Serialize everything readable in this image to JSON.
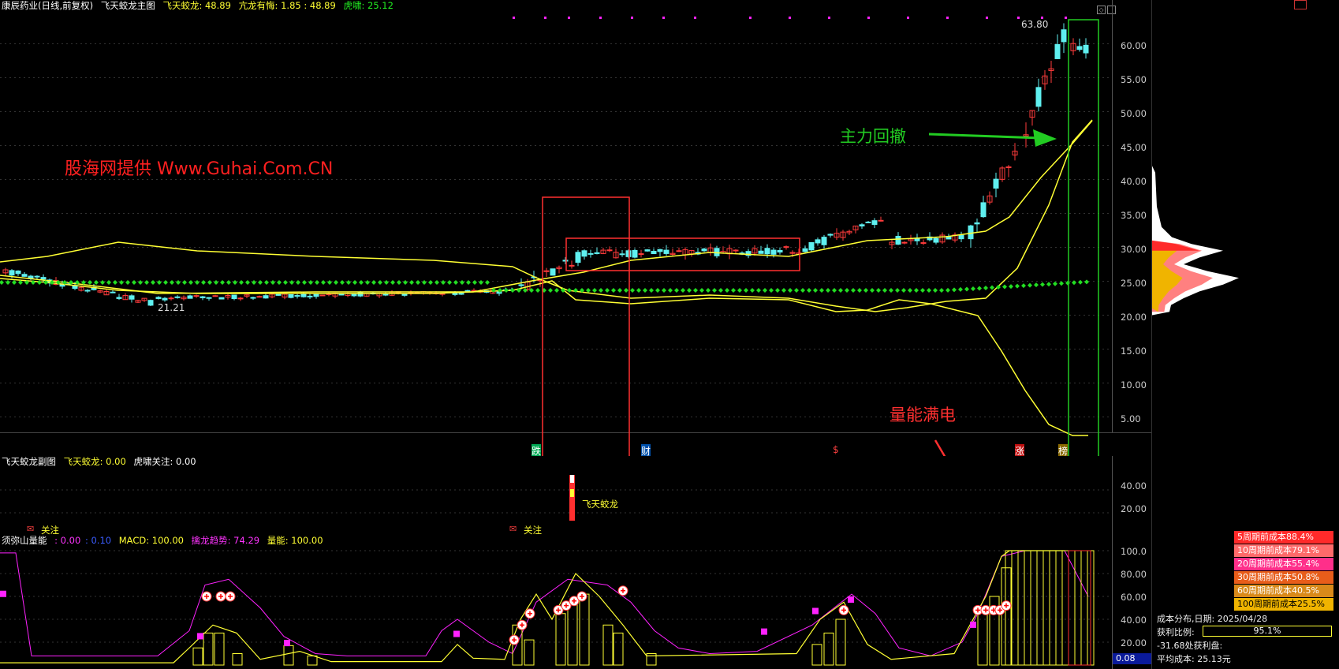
{
  "main_header": {
    "stock": "康辰药业(日线,前复权)",
    "indicator": "飞天蛟龙主图",
    "v1_label": "飞天蛟龙: 48.89",
    "v2_label": "亢龙有悔: 1.85 : 48.89",
    "v3_label": "虎啸: 25.12"
  },
  "main_annotations": {
    "watermark": "股海网提供 Www.Guhai.Com.CN",
    "pullback": "主力回撤",
    "energy": "量能满电",
    "high_price": "63.80",
    "low_price": "21.21"
  },
  "signal_marks": [
    "跌",
    "财",
    "$",
    "涨",
    "榜"
  ],
  "main_axis": [
    "60.00",
    "55.00",
    "50.00",
    "45.00",
    "40.00",
    "35.00",
    "30.00",
    "25.00",
    "20.00",
    "15.00",
    "10.00",
    "5.00"
  ],
  "sub_header": {
    "name": "飞天蛟龙副图",
    "v1": "飞天蛟龙: 0.00",
    "v2": "虎啸关注: 0.00"
  },
  "sub_annotations": {
    "dragon": "飞天蛟龙",
    "focus1": "关注",
    "focus2": "关注"
  },
  "sub_axis": [
    "40.00",
    "20.00"
  ],
  "vol_header": {
    "name": "须弥山量能",
    "v1": ": 0.00",
    "v2": ": 0.10",
    "v3": "MACD: 100.00",
    "v4": "擒龙趋势: 74.29",
    "v5": "量能: 100.00"
  },
  "vol_axis": [
    "100.0",
    "80.00",
    "60.00",
    "40.00",
    "20.00"
  ],
  "vol_axis_badge": "0.08",
  "cost_legend": [
    {
      "label": "5周期前成本88.4%",
      "color": "#ff2a2a"
    },
    {
      "label": "10周期前成本79.1%",
      "color": "#ff6a6a"
    },
    {
      "label": "20周期前成本55.4%",
      "color": "#ff2f8a"
    },
    {
      "label": "30周期前成本50.8%",
      "color": "#e85d1a"
    },
    {
      "label": "60周期前成本40.5%",
      "color": "#d98a1a"
    },
    {
      "label": "100周期前成本25.5%",
      "color": "#f0b400"
    }
  ],
  "cost_info": {
    "date_line": "成本分布,日期: 2025/04/28",
    "profit_label": "获利比例:",
    "profit_value": "95.1%",
    "profit_fraction": 0.951,
    "break_line": "-31.68处获利盘:",
    "avg_line": "平均成本: 25.13元"
  },
  "colors": {
    "up": "#ff3b3b",
    "down": "#5ff0f0",
    "ma": "#ffff33",
    "green_dot": "#22dd22",
    "magenta": "#ff22ff",
    "box_red": "#ff3030",
    "box_green": "#22cc22"
  }
}
